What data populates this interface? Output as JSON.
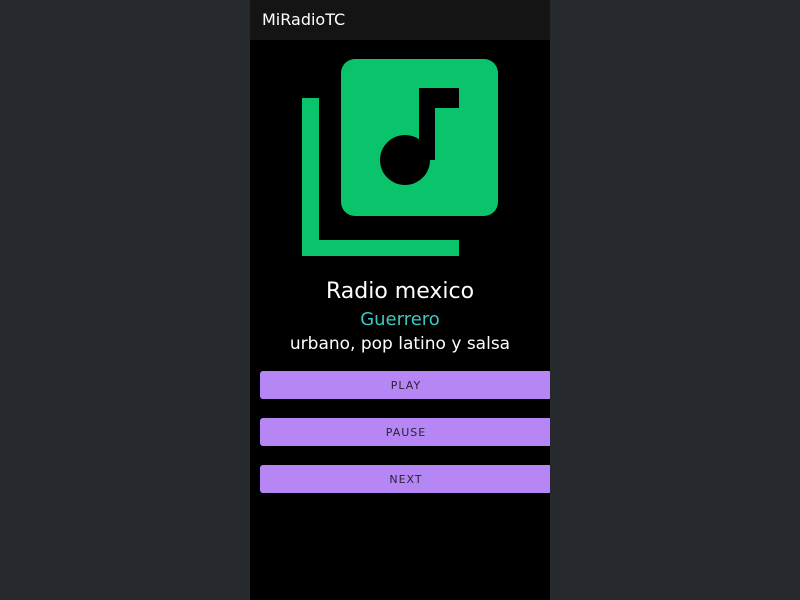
{
  "app": {
    "title": "MiRadioTC"
  },
  "station": {
    "name": "Radio mexico",
    "region": "Guerrero",
    "genre": "urbano, pop latino y salsa",
    "artwork_icon": "music-library-icon"
  },
  "controls": {
    "play_label": "PLAY",
    "pause_label": "PAUSE",
    "next_label": "NEXT"
  },
  "colors": {
    "background": "#000000",
    "appbar": "#141414",
    "artwork": "#0ac46c",
    "region_text": "#3cc9bd",
    "button": "#b686f5"
  }
}
